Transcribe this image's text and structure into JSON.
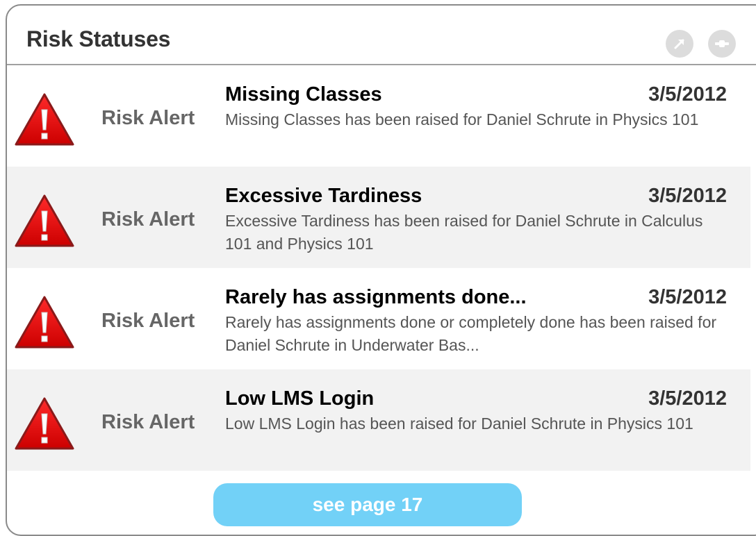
{
  "panel": {
    "title": "Risk Statuses",
    "header_icons": [
      "expand-icon",
      "minimize-icon"
    ]
  },
  "alerts": [
    {
      "icon": "warning-icon",
      "type": "Risk Alert",
      "title": "Missing Classes",
      "date": "3/5/2012",
      "description": "Missing Classes has been raised for Daniel Schrute in Physics 101"
    },
    {
      "icon": "warning-icon",
      "type": "Risk Alert",
      "title": "Excessive Tardiness",
      "date": "3/5/2012",
      "description": "Excessive Tardiness has been raised for Daniel Schrute in Calculus 101 and Physics 101"
    },
    {
      "icon": "warning-icon",
      "type": "Risk Alert",
      "title": "Rarely has assignments done...",
      "date": "3/5/2012",
      "description": "Rarely has assignments done or completely done has been raised for Daniel Schrute in Underwater Bas..."
    },
    {
      "icon": "warning-icon",
      "type": "Risk Alert",
      "title": "Low LMS Login",
      "date": "3/5/2012",
      "description": "Low LMS Login has been raised for Daniel Schrute in Physics 101"
    }
  ],
  "footer": {
    "see_more_label": "see page 17"
  },
  "colors": {
    "warning_red": "#e00000",
    "button_blue": "#72d1f7",
    "row_alt_bg": "#f2f2f2"
  }
}
